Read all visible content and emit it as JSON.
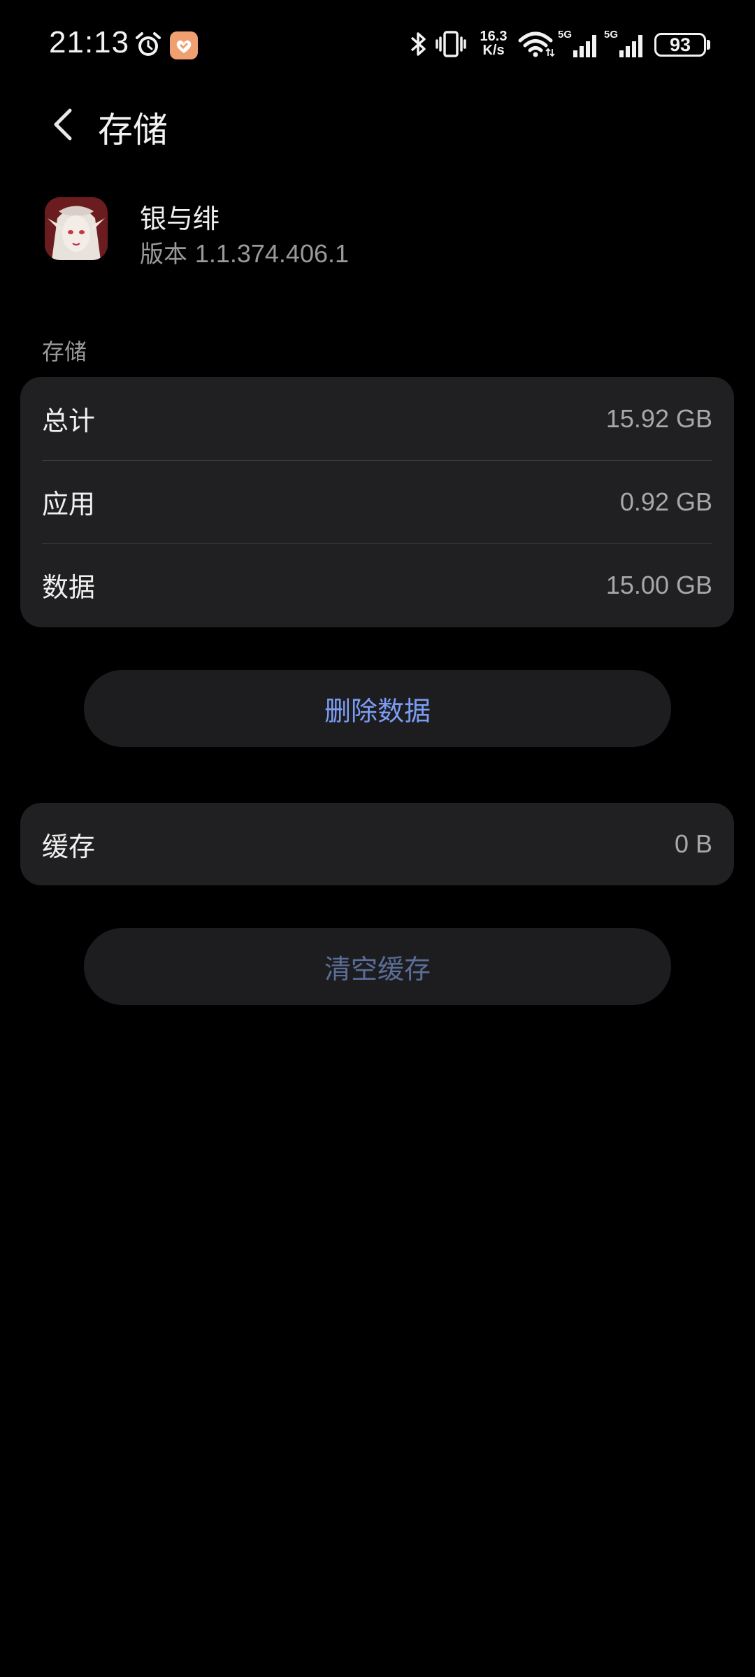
{
  "status_bar": {
    "time": "21:13",
    "net_speed_value": "16.3",
    "net_speed_unit": "K/s",
    "signal1_label": "5G",
    "signal2_label": "5G",
    "battery": "93",
    "icons": [
      "alarm-icon",
      "app-notification-icon",
      "bluetooth-icon",
      "vibrate-icon",
      "wifi-icon",
      "signal-icon",
      "signal-icon",
      "battery-icon"
    ]
  },
  "header": {
    "title": "存储",
    "back_icon": "chevron-left-icon"
  },
  "app": {
    "name": "银与绯",
    "version_prefix": "版本",
    "version": "1.1.374.406.1"
  },
  "storage": {
    "section_label": "存储",
    "rows": [
      {
        "label": "总计",
        "value": "15.92 GB"
      },
      {
        "label": "应用",
        "value": "0.92 GB"
      },
      {
        "label": "数据",
        "value": "15.00 GB"
      }
    ],
    "delete_button": "删除数据"
  },
  "cache": {
    "label": "缓存",
    "value": "0 B",
    "clear_button": "清空缓存"
  },
  "colors": {
    "background": "#000000",
    "card": "#202022",
    "accent": "#7c9cf4",
    "accent_disabled": "#5b6e99"
  }
}
